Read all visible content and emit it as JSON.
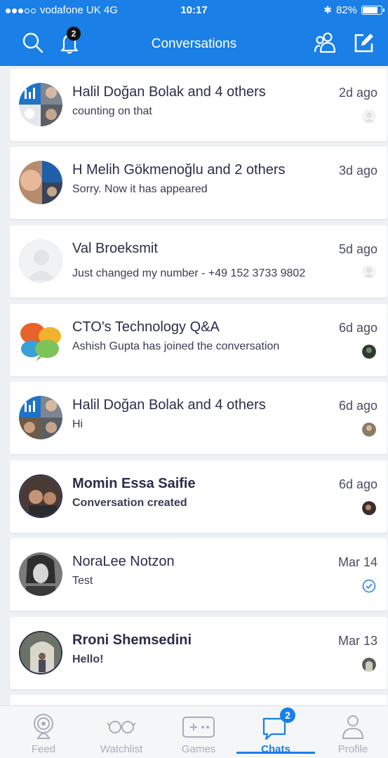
{
  "status_bar": {
    "carrier": "vodafone UK  4G",
    "time": "10:17",
    "battery": "82%",
    "battery_level": 0.82,
    "signal_bars_filled": 3,
    "signal_bars_total": 5
  },
  "nav": {
    "title": "Conversations",
    "notification_count": "2",
    "icons": [
      "search-icon",
      "bell-icon",
      "people-icon",
      "compose-icon"
    ]
  },
  "chats": [
    {
      "name": "Halil Doğan Bolak and 4 others",
      "message": "counting on that",
      "time": "2d ago",
      "bold": false
    },
    {
      "name": "H Melih Gökmenoğlu and 2 others",
      "message": "Sorry. Now it has appeared",
      "time": "3d ago",
      "bold": false
    },
    {
      "name": "Val  Broeksmit",
      "message": "Just changed my number - +49 152 3733 9802",
      "time": "5d ago",
      "bold": false
    },
    {
      "name": "CTO's Technology Q&A",
      "message": "Ashish Gupta has joined the conversation",
      "time": "6d ago",
      "bold": false
    },
    {
      "name": "Halil Doğan Bolak and 4 others",
      "message": "Hi",
      "time": "6d ago",
      "bold": false
    },
    {
      "name": "Momin Essa Saifie",
      "message": "Conversation created",
      "time": "6d ago",
      "bold": true
    },
    {
      "name": "NoraLee Notzon",
      "message": "Test",
      "time": "Mar 14",
      "bold": false
    },
    {
      "name": "Rroni Shemsedini",
      "message": "Hello!",
      "time": "Mar 13",
      "bold": true
    }
  ],
  "tabs": [
    {
      "label": "Feed",
      "icon": "feed-icon",
      "active": false
    },
    {
      "label": "Watchlist",
      "icon": "glasses-icon",
      "active": false
    },
    {
      "label": "Games",
      "icon": "gamepad-icon",
      "active": false
    },
    {
      "label": "Chats",
      "icon": "chat-bubble-icon",
      "active": true,
      "badge": "2"
    },
    {
      "label": "Profile",
      "icon": "person-icon",
      "active": false
    }
  ],
  "colors": {
    "brand_blue": "#1a7fe6",
    "text_dark": "#2b2d4a",
    "tab_inactive": "#a9aebb"
  }
}
